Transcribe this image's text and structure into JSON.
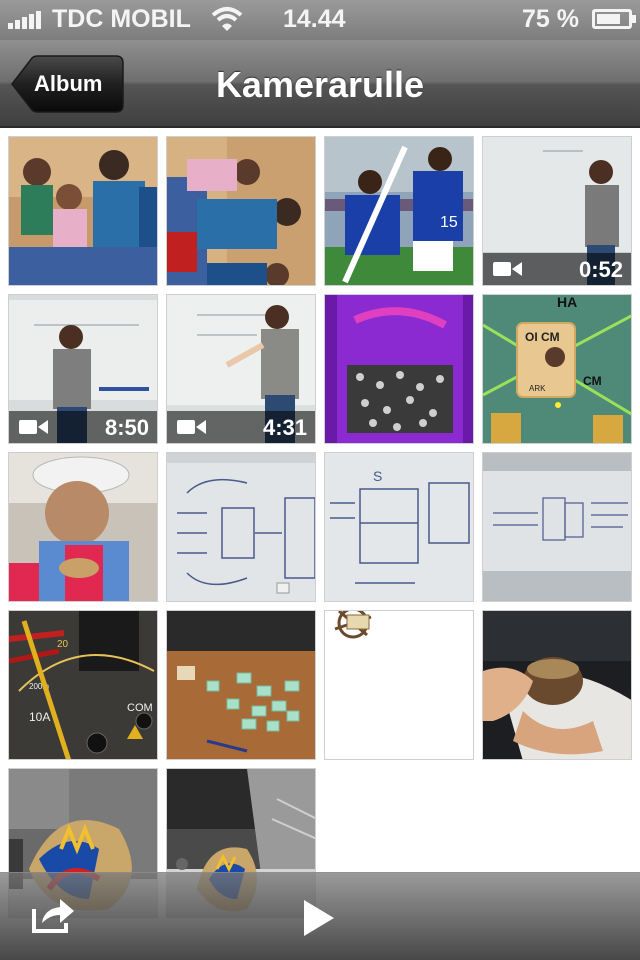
{
  "status_bar": {
    "carrier": "TDC MOBIL",
    "time": "14.44",
    "battery_percent": "75 %",
    "battery_level": 0.75,
    "signal_icon": "signal-bars-icon",
    "wifi_icon": "wifi-icon",
    "battery_icon": "battery-icon"
  },
  "nav": {
    "back_label": "Album",
    "title": "Kamerarulle"
  },
  "grid": {
    "videos": [
      {
        "duration": "0:52"
      },
      {
        "duration": "8:50"
      },
      {
        "duration": "4:31"
      }
    ]
  },
  "toolbar": {
    "share_icon": "share-icon",
    "play_icon": "play-icon"
  },
  "colors": {
    "status_bar": "#8a8a8a",
    "nav_bar": "#5a5a5a",
    "tile_border": "#cfcfcf"
  }
}
